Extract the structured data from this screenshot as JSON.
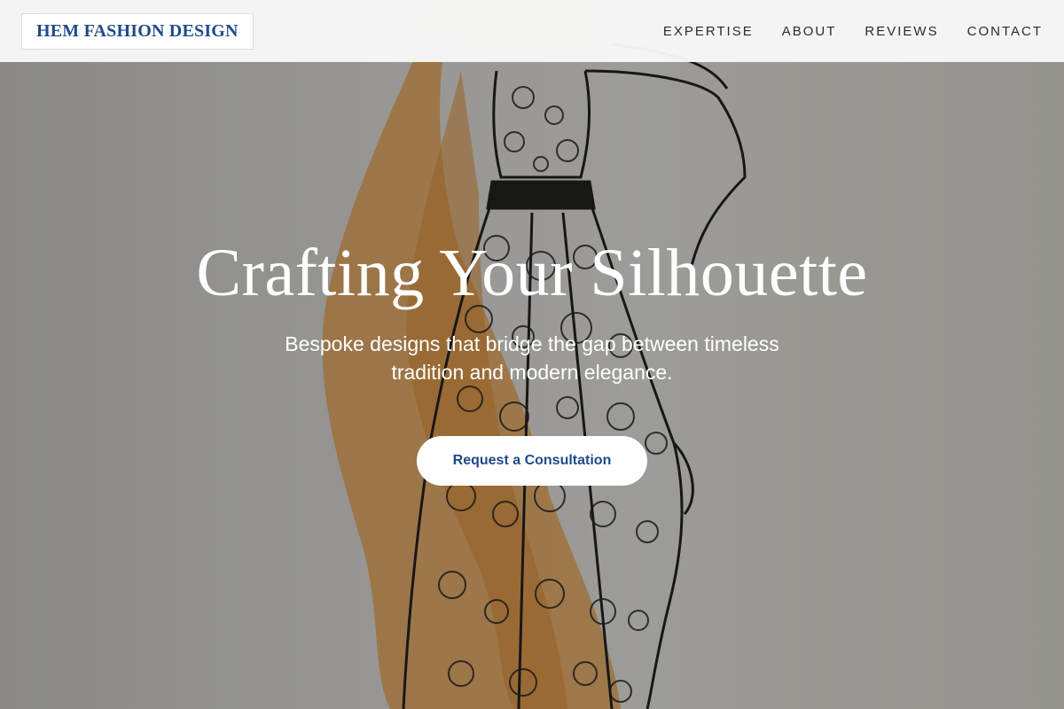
{
  "brand": {
    "name": "HEM FASHION DESIGN",
    "color": "#1f4a8a"
  },
  "nav": {
    "items": [
      {
        "label": "EXPERTISE"
      },
      {
        "label": "ABOUT"
      },
      {
        "label": "REVIEWS"
      },
      {
        "label": "CONTACT"
      }
    ]
  },
  "hero": {
    "title": "Crafting Your Silhouette",
    "subtitle": "Bespoke designs that bridge the gap between timeless tradition and modern elegance.",
    "cta_label": "Request a Consultation",
    "background": "fashion-sketch-illustration"
  }
}
